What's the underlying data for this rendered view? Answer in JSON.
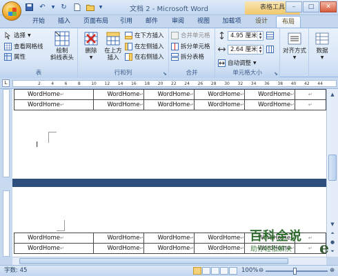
{
  "window": {
    "title": "文档 2 - Microsoft Word",
    "context_title": "表格工具"
  },
  "tabs": [
    {
      "label": "开始"
    },
    {
      "label": "插入"
    },
    {
      "label": "页面布局"
    },
    {
      "label": "引用"
    },
    {
      "label": "邮件"
    },
    {
      "label": "审阅"
    },
    {
      "label": "视图"
    },
    {
      "label": "加载项"
    },
    {
      "label": "设计"
    },
    {
      "label": "布局"
    }
  ],
  "active_tab": "布局",
  "ribbon": {
    "table_group": {
      "label": "表",
      "select": "选择",
      "view_gridlines": "查看网格线",
      "properties": "属性",
      "draw_diagonal": "绘制\n斜线表头"
    },
    "rows_cols_group": {
      "label": "行和列",
      "delete": "删除",
      "insert_above": "在上方\n插入",
      "insert_below": "在下方插入",
      "insert_left": "在左侧插入",
      "insert_right": "在右侧插入"
    },
    "merge_group": {
      "label": "合并",
      "merge_cells": "合并单元格",
      "split_cells": "拆分单元格",
      "split_table": "拆分表格"
    },
    "cell_size_group": {
      "label": "单元格大小",
      "height_value": "4.95 厘米",
      "width_value": "2.64 厘米",
      "autofit": "自动调整"
    },
    "alignment": {
      "label": "对齐方式"
    },
    "data": {
      "label": "数据"
    }
  },
  "ruler": {
    "numbers": [
      "2",
      "4",
      "6",
      "8",
      "10",
      "12",
      "14",
      "16",
      "18",
      "20",
      "22",
      "24",
      "26",
      "28",
      "30",
      "32",
      "34",
      "36",
      "38",
      "40",
      "42",
      "44"
    ]
  },
  "document": {
    "cell_text": "WordHome",
    "return_mark": "↵"
  },
  "status": {
    "word_count": "字数: 45",
    "zoom": "100%"
  },
  "watermark": {
    "title": "百科全说",
    "subtitle": "助你轻松解决",
    "logo": "e"
  }
}
